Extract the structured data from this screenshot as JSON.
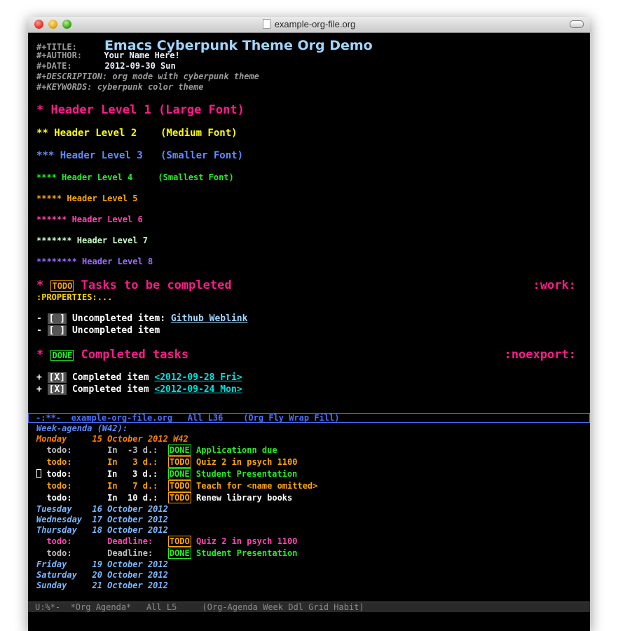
{
  "window": {
    "title": "example-org-file.org"
  },
  "meta": {
    "title_kw": "#+TITLE:",
    "title": "Emacs Cyberpunk Theme Org Demo",
    "author_kw": "#+AUTHOR:",
    "author": "Your Name Here!",
    "date_kw": "#+DATE:",
    "date": "2012-09-30 Sun",
    "description": "#+DESCRIPTION: org mode with cyberpunk theme",
    "keywords": "#+KEYWORDS: cyberpunk color theme"
  },
  "headers": {
    "h1": "* Header Level 1 (Large Font)",
    "h2": "** Header Level 2    (Medium Font)",
    "h3": "*** Header Level 3   (Smaller Font)",
    "h4": "**** Header Level 4     (Smallest Font)",
    "h5": "***** Header Level 5",
    "h6": "****** Header Level 6",
    "h7": "******* Header Level 7",
    "h8": "******** Header Level 8"
  },
  "tasks": {
    "star": "* ",
    "todo_kw": "TODO",
    "todo_title": " Tasks to be completed",
    "todo_tag": ":work:",
    "properties": ":PROPERTIES:...",
    "item1_prefix": "- ",
    "checkbox_empty": "[ ]",
    "item1_text": " Uncompleted item: ",
    "item1_link": "Github Weblink",
    "item2_prefix": "- ",
    "item2_text": " Uncompleted item",
    "done_kw": "DONE",
    "done_title": " Completed tasks",
    "done_tag": ":noexport:",
    "item3_prefix": "+ ",
    "checkbox_checked": "[X]",
    "item3_text": " Completed item ",
    "item3_date": "<2012-09-28 Fri>",
    "item4_text": " Completed item ",
    "item4_date": "<2012-09-24 Mon>"
  },
  "modeline": {
    "text": "-:**-  example-org-file.org   All L36    (Org Fly Wrap Fill)"
  },
  "agenda": {
    "week": "Week-agenda (W42):",
    "today_label": "Monday     15 October 2012 W42",
    "items": [
      {
        "cat": "  todo:",
        "when": "       In  -3 d.:  ",
        "kw": "DONE",
        "text": " Applicationn due"
      },
      {
        "cat": "  todo:",
        "when": "       In   3 d.:  ",
        "kw": "TODO",
        "text": " Quiz 2 in psych 1100"
      },
      {
        "cat": " todo:",
        "when": "       In   3 d.:  ",
        "kw": "DONE",
        "text": " Student Presentation"
      },
      {
        "cat": "  todo:",
        "when": "       In   7 d.:  ",
        "kw": "TODO",
        "text": " Teach for <name omitted>"
      },
      {
        "cat": "  todo:",
        "when": "       In  10 d.:  ",
        "kw": "TODO",
        "text": " Renew library books"
      }
    ],
    "days_a": [
      "Tuesday    16 October 2012",
      "Wednesday  17 October 2012",
      "Thursday   18 October 2012"
    ],
    "deadline_items": [
      {
        "cat": "  todo:",
        "when": "       Deadline:   ",
        "kw": "TODO",
        "text": " Quiz 2 in psych 1100"
      },
      {
        "cat": "  todo:",
        "when": "       Deadline:   ",
        "kw": "DONE",
        "text": " Student Presentation"
      }
    ],
    "days_b": [
      "Friday     19 October 2012",
      "Saturday   20 October 2012",
      "Sunday     21 October 2012"
    ]
  },
  "modeline2": {
    "text": "U:%*-  *Org Agenda*   All L5     (Org-Agenda Week Ddl Grid Habit)"
  }
}
